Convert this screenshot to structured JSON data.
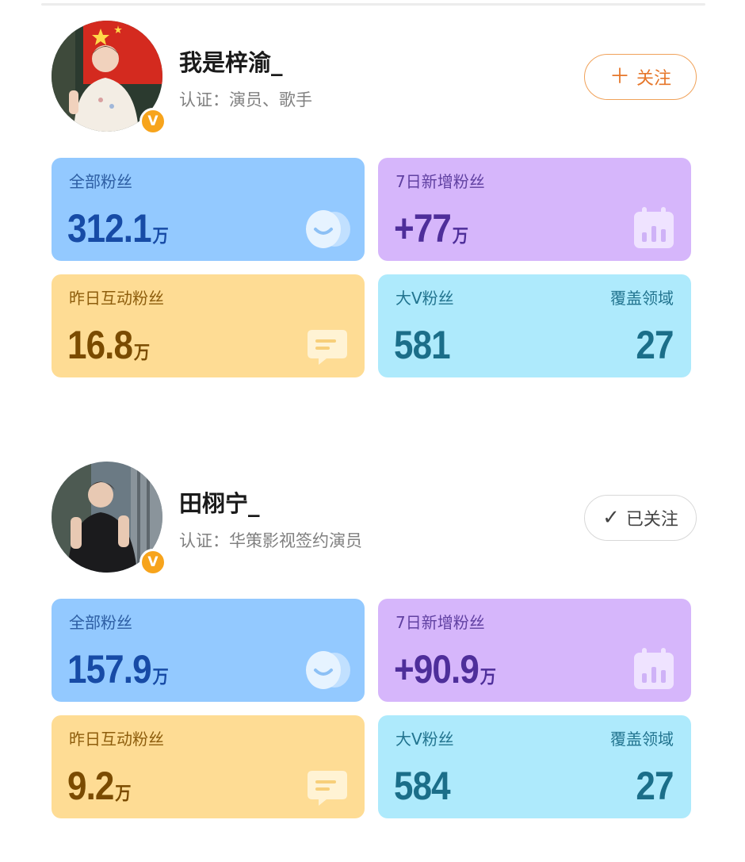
{
  "profiles": [
    {
      "name": "我是梓渝_",
      "certification": "认证：演员、歌手",
      "follow_button": {
        "label": "关注",
        "icon": "plus-icon",
        "state": "not-following"
      },
      "verified_badge": "V",
      "stats": {
        "total_fans": {
          "label": "全部粉丝",
          "value": "312.1",
          "unit": "万"
        },
        "new_fans_7d": {
          "label": "7日新增粉丝",
          "value": "+77",
          "unit": "万"
        },
        "interactive_fans": {
          "label": "昨日互动粉丝",
          "value": "16.8",
          "unit": "万"
        },
        "bigv_fans": {
          "label": "大V粉丝",
          "value": "581",
          "coverage_label": "覆盖领域",
          "coverage_value": "27"
        }
      }
    },
    {
      "name": "田栩宁_",
      "certification": "认证：华策影视签约演员",
      "follow_button": {
        "label": "已关注",
        "icon": "checkmark-icon",
        "state": "following"
      },
      "verified_badge": "V",
      "stats": {
        "total_fans": {
          "label": "全部粉丝",
          "value": "157.9",
          "unit": "万"
        },
        "new_fans_7d": {
          "label": "7日新增粉丝",
          "value": "+90.9",
          "unit": "万"
        },
        "interactive_fans": {
          "label": "昨日互动粉丝",
          "value": "9.2",
          "unit": "万"
        },
        "bigv_fans": {
          "label": "大V粉丝",
          "value": "584",
          "coverage_label": "覆盖领域",
          "coverage_value": "27"
        }
      }
    }
  ],
  "icons": {
    "follow_plus": "＋",
    "follow_check": "✓"
  },
  "colors": {
    "total_fans_card": "#93c9ff",
    "new_fans_card": "#d6b6fb",
    "interactive_card": "#fedc94",
    "bigv_card": "#aeeafc",
    "follow_accent": "#e6772b",
    "verified_badge": "#f7a41c"
  }
}
